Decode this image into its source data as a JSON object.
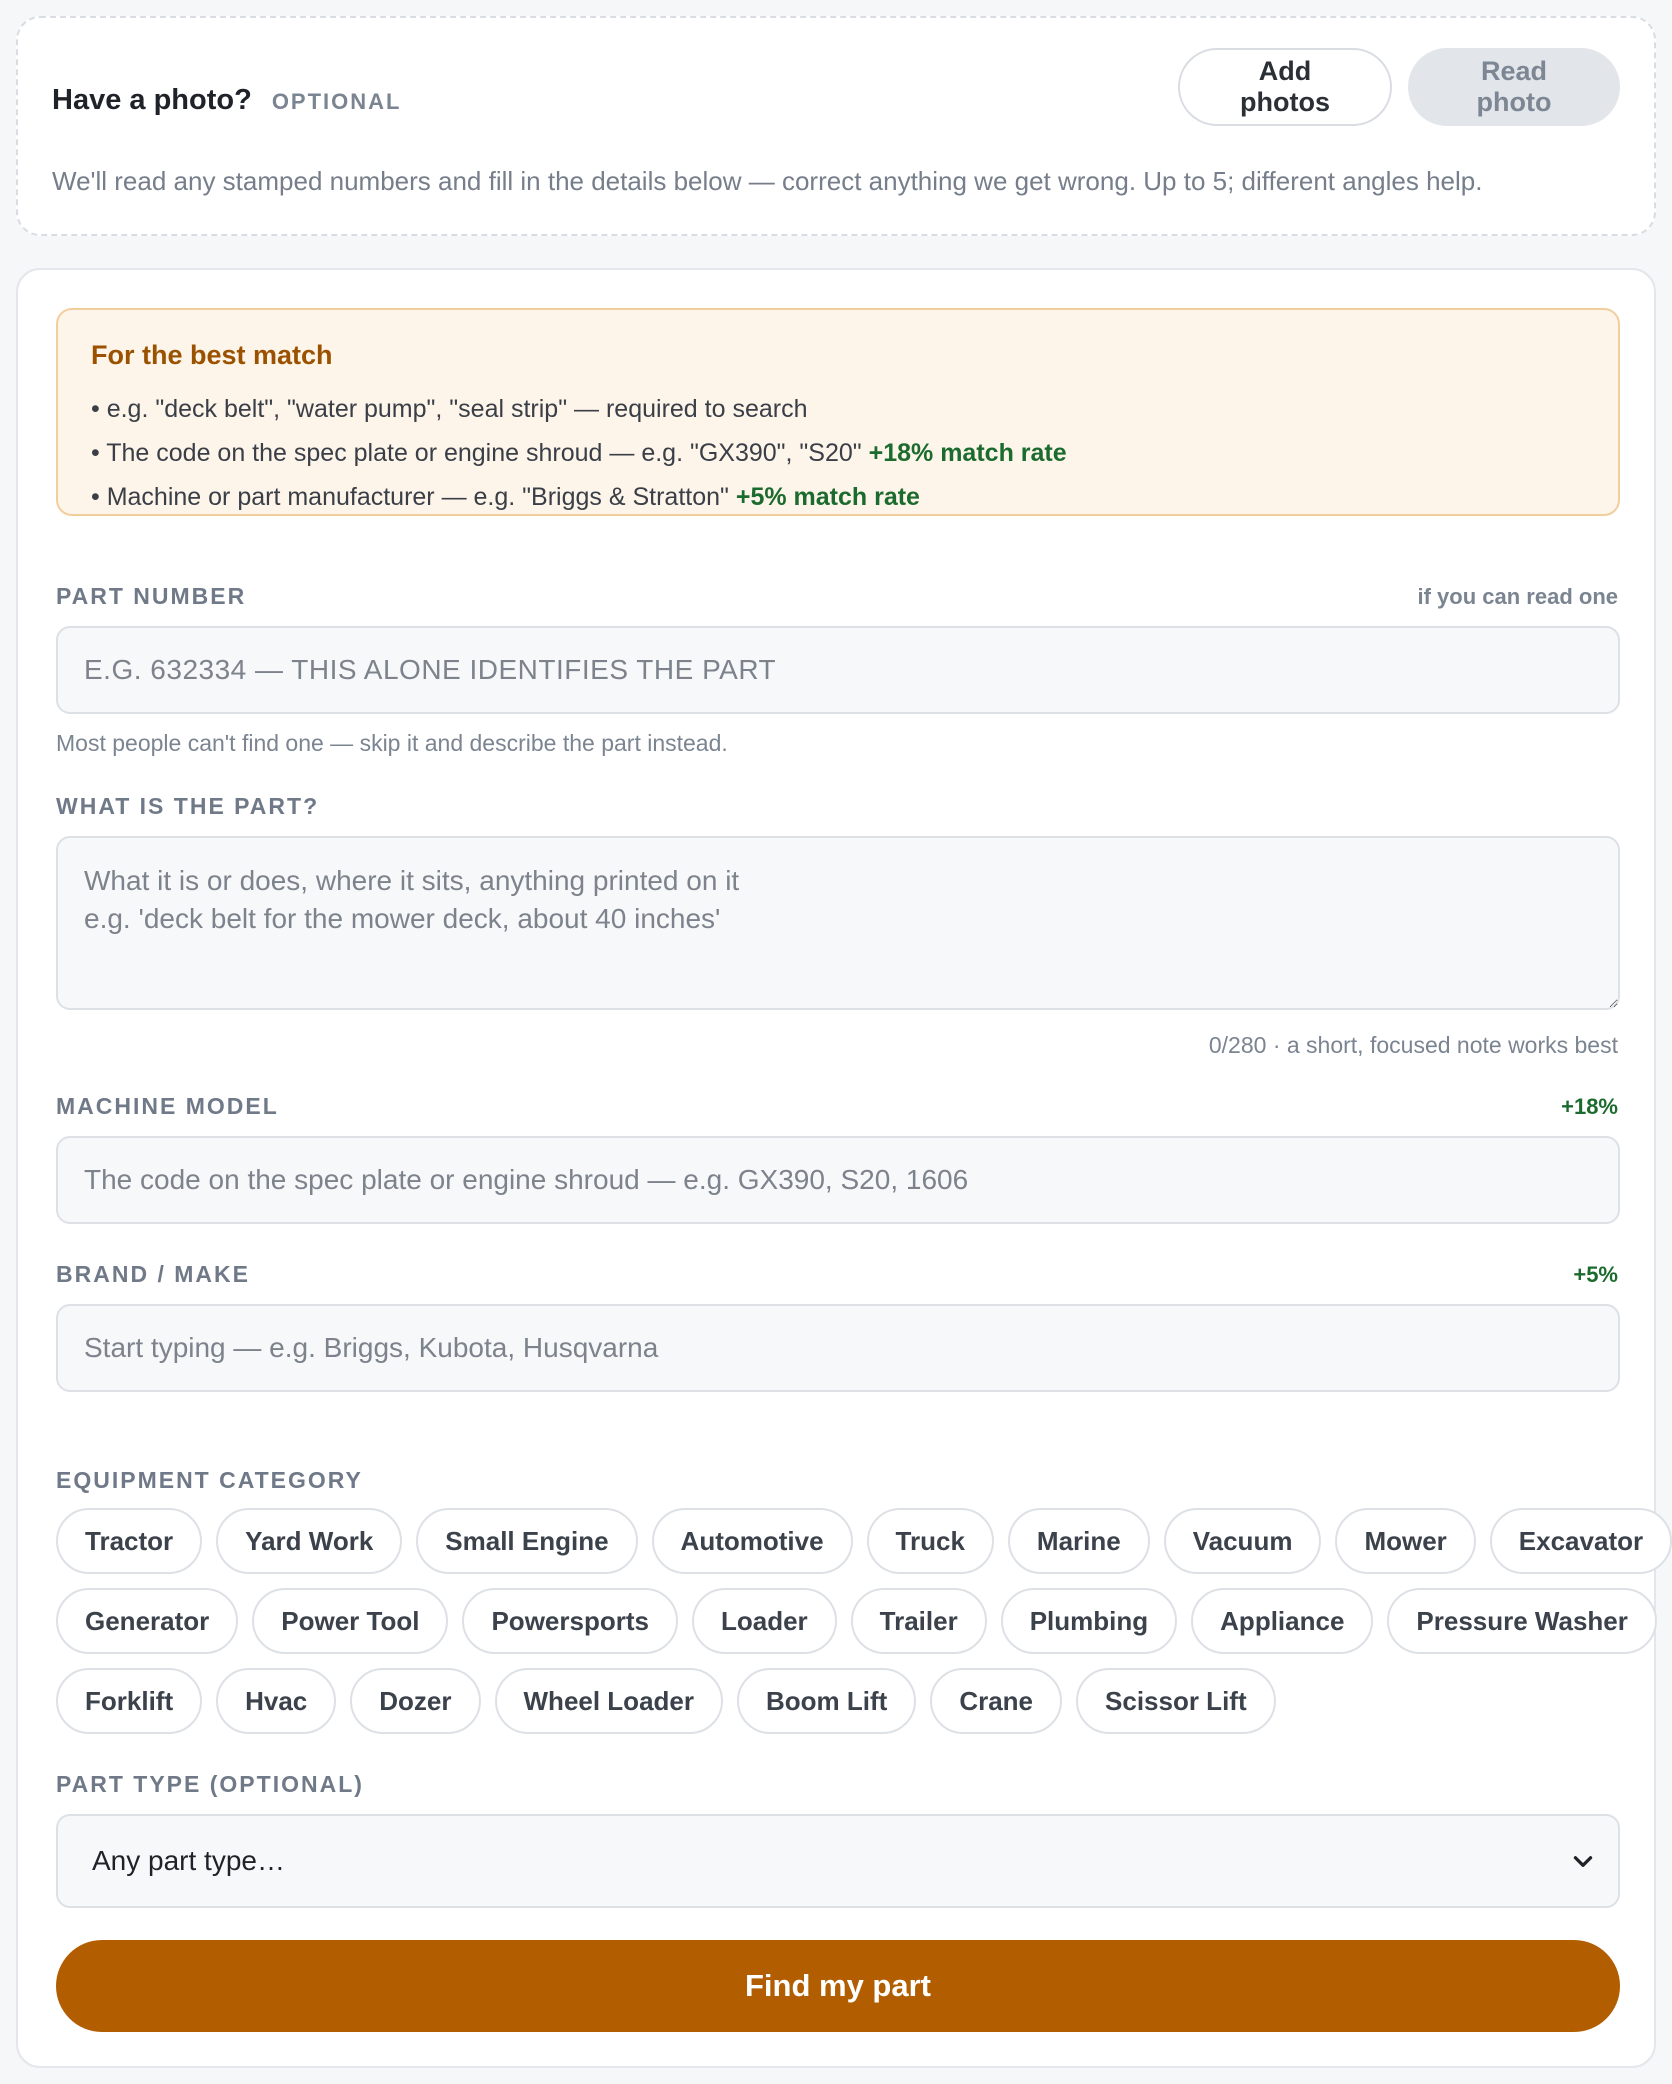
{
  "photo": {
    "title": "Have a photo?",
    "optional_tag": "OPTIONAL",
    "add_button": "Add photos",
    "read_button": "Read photo",
    "description": "We'll read any stamped numbers and fill in the details below — correct anything we get wrong. Up to 5; different angles help."
  },
  "tips": {
    "title": "For the best match",
    "items": [
      {
        "text": "• e.g. \"deck belt\", \"water pump\", \"seal strip\" — required to search",
        "gain": ""
      },
      {
        "text": "• The code on the spec plate or engine shroud — e.g. \"GX390\", \"S20\"",
        "gain": "+18% match rate"
      },
      {
        "text": "• Machine or part manufacturer — e.g. \"Briggs & Stratton\"",
        "gain": "+5% match rate"
      }
    ]
  },
  "part_number": {
    "label": "PART NUMBER",
    "aside": "if you can read one",
    "value": "",
    "placeholder": "E.G. 632334 — THIS ALONE IDENTIFIES THE PART",
    "helper": "Most people can't find one — skip it and describe the part instead."
  },
  "part_description": {
    "label": "WHAT IS THE PART?",
    "value": "",
    "placeholder": "What it is or does, where it sits, anything printed on it\ne.g. 'deck belt for the mower deck, about 40 inches'",
    "counter": "0/280 · a short, focused note works best"
  },
  "machine_model": {
    "label": "MACHINE MODEL",
    "aside": "+18%",
    "value": "",
    "placeholder": "The code on the spec plate or engine shroud — e.g. GX390, S20, 1606"
  },
  "brand": {
    "label": "BRAND / MAKE",
    "aside": "+5%",
    "value": "",
    "placeholder": "Start typing — e.g. Briggs, Kubota, Husqvarna"
  },
  "equipment": {
    "label": "EQUIPMENT CATEGORY",
    "rows": [
      [
        "Tractor",
        "Yard Work",
        "Small Engine",
        "Automotive",
        "Truck",
        "Marine",
        "Vacuum",
        "Mower",
        "Excavator"
      ],
      [
        "Generator",
        "Power Tool",
        "Powersports",
        "Loader",
        "Trailer",
        "Plumbing",
        "Appliance",
        "Pressure Washer"
      ],
      [
        "Forklift",
        "Hvac",
        "Dozer",
        "Wheel Loader",
        "Boom Lift",
        "Crane",
        "Scissor Lift"
      ]
    ]
  },
  "part_type": {
    "label": "PART TYPE (OPTIONAL)",
    "selected": "Any part type…",
    "icon": "chevron-down-icon"
  },
  "submit": {
    "label": "Find my part"
  },
  "colors": {
    "accent": "#b25d00",
    "gain_green": "#1c6b2e",
    "tips_bg": "#fdf4ea",
    "tips_title": "#9a5200"
  }
}
